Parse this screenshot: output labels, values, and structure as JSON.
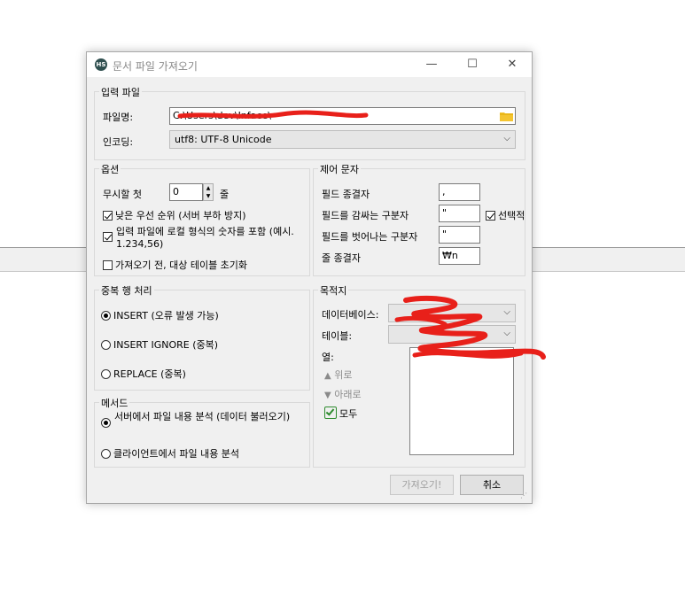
{
  "window": {
    "title": "문서 파일 가져오기",
    "app_icon": "HS"
  },
  "input_file": {
    "legend": "입력 파일",
    "filename_label": "파일명:",
    "filename_value": "C:\\Users\\dev\\Inface\\",
    "encoding_label": "인코딩:",
    "encoding_value": "utf8: UTF-8 Unicode"
  },
  "options": {
    "legend": "옵션",
    "ignore_label": "무시할 첫",
    "ignore_value": "0",
    "ignore_unit": "줄",
    "low_priority": "낮은 우선 순위 (서버 부하 방지)",
    "local_number": "입력 파일에 로컬 형식의 숫자를 포함 (예시. 1.234,56)",
    "truncate": "가져오기 전, 대상 테이블 초기화"
  },
  "control_chars": {
    "legend": "제어 문자",
    "field_terminator_label": "필드 종결자",
    "field_terminator_value": ",",
    "field_enclosure_label": "필드를 감싸는 구분자",
    "field_enclosure_value": "\"",
    "optional_label": "선택적",
    "field_escape_label": "필드를 벗어나는 구분자",
    "field_escape_value": "\"",
    "line_terminator_label": "줄 종결자",
    "line_terminator_value": "₩n"
  },
  "duplicates": {
    "legend": "중복 행 처리",
    "insert": "INSERT (오류 발생 가능)",
    "insert_ignore": "INSERT IGNORE (중복)",
    "replace": "REPLACE (중복)"
  },
  "destination": {
    "legend": "목적지",
    "database_label": "데이터베이스:",
    "table_label": "테이블:",
    "columns_label": "열:",
    "up": "위로",
    "down": "아래로",
    "all": "모두"
  },
  "method": {
    "legend": "메서드",
    "server": "서버에서 파일 내용 분석 (데이터 불러오기)",
    "client": "클라이언트에서 파일 내용 분석"
  },
  "buttons": {
    "import": "가져오기!",
    "cancel": "취소"
  },
  "colors": {
    "redaction": "#e8201a",
    "checked_accent": "#2e8b2e"
  }
}
